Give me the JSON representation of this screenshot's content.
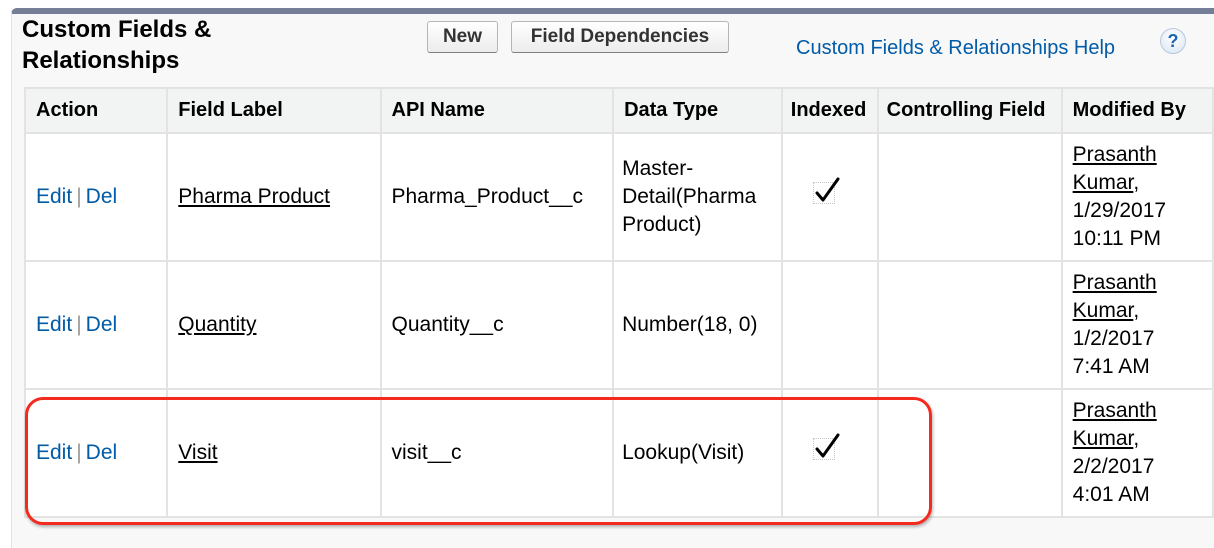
{
  "header": {
    "title_line1": "Custom Fields &",
    "title_line2": "Relationships",
    "new_button": "New",
    "field_dependencies_button": "Field Dependencies",
    "help_link": "Custom Fields & Relationships Help",
    "help_icon": "?"
  },
  "table": {
    "columns": [
      "Action",
      "Field Label",
      "API Name",
      "Data Type",
      "Indexed",
      "Controlling Field",
      "Modified By"
    ],
    "rows": [
      {
        "edit": "Edit",
        "sep": "|",
        "del": "Del",
        "field_label": "Pharma Product",
        "api_name": "Pharma_Product__c",
        "data_type": "Master-Detail(Pharma Product)",
        "indexed": true,
        "controlling_field": "",
        "modified_by_user": "Prasanth Kumar",
        "modified_date": "1/29/2017",
        "modified_time": "10:11 PM"
      },
      {
        "edit": "Edit",
        "sep": "|",
        "del": "Del",
        "field_label": "Quantity",
        "api_name": "Quantity__c",
        "data_type": "Number(18, 0)",
        "indexed": false,
        "controlling_field": "",
        "modified_by_user": "Prasanth Kumar",
        "modified_date": "1/2/2017",
        "modified_time": "7:41 AM"
      },
      {
        "edit": "Edit",
        "sep": "|",
        "del": "Del",
        "field_label": "Visit",
        "api_name": "visit__c",
        "data_type": "Lookup(Visit)",
        "indexed": true,
        "controlling_field": "",
        "modified_by_user": "Prasanth Kumar",
        "modified_date": "2/2/2017",
        "modified_time": "4:01 AM"
      }
    ]
  },
  "colors": {
    "link": "#015ba7",
    "header_bar": "#747e96",
    "highlight": "#f52a1f",
    "table_header_bg": "#f2f3f3"
  },
  "annotation": {
    "highlighted_row": "Visit"
  }
}
